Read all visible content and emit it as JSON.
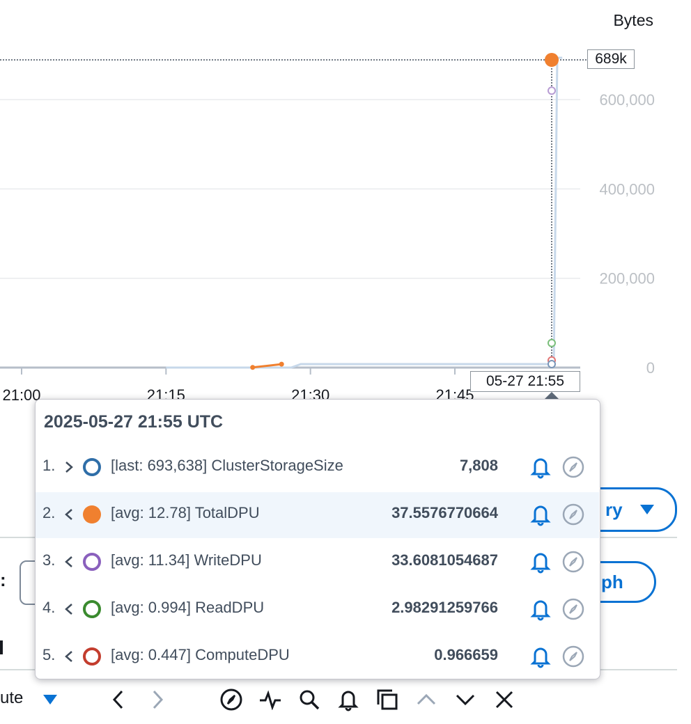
{
  "chart_data": {
    "type": "line",
    "ylabel": "Bytes",
    "yticks": [
      "0",
      "200,000",
      "400,000",
      "600,000"
    ],
    "ylim": [
      0,
      700000
    ],
    "xticks": [
      "21:00",
      "21:15",
      "21:30",
      "21:45"
    ],
    "xlim_minutes": [
      0,
      61
    ],
    "hover_value_label": "689k",
    "hover_time_label": "05-27 21:55",
    "series": [
      {
        "name": "ClusterStorageSize",
        "color": "#c7d8ea",
        "points": [
          [
            15,
            0
          ],
          [
            28,
            0
          ],
          [
            29,
            7808
          ],
          [
            55,
            7808
          ],
          [
            55.4,
            693638
          ],
          [
            56,
            693638
          ]
        ]
      },
      {
        "name": "TotalDPU",
        "color": "#f0802f",
        "points": [
          [
            24,
            400
          ],
          [
            27,
            7600
          ]
        ]
      }
    ],
    "hover_markers": [
      {
        "name": "TotalDPU",
        "color": "#f0802f",
        "value": 689000,
        "filled": true
      },
      {
        "name": "WriteDPU",
        "color": "#b79bd3",
        "value": 620000,
        "filled": false
      },
      {
        "name": "ReadDPU",
        "color": "#7bbf7b",
        "value": 55000,
        "filled": false
      },
      {
        "name": "ComputeDPU",
        "color": "#e27676",
        "value": 16000,
        "filled": false
      },
      {
        "name": "ClusterStorageSize",
        "color": "#7a96b8",
        "value": 7808,
        "filled": false
      }
    ]
  },
  "popover": {
    "title": "2025-05-27 21:55 UTC",
    "rows": [
      {
        "num": "1.",
        "chevron": "right",
        "color": "#2f6ea8",
        "filled": false,
        "label": "[last: 693,638] ClusterStorageSize",
        "value": "7,808",
        "highlight": false
      },
      {
        "num": "2.",
        "chevron": "left",
        "color": "#f0802f",
        "filled": true,
        "label": "[avg: 12.78] TotalDPU",
        "value": "37.5576770664",
        "highlight": true
      },
      {
        "num": "3.",
        "chevron": "left",
        "color": "#8a60bd",
        "filled": false,
        "label": "[avg: 11.34] WriteDPU",
        "value": "33.6081054687",
        "highlight": false
      },
      {
        "num": "4.",
        "chevron": "left",
        "color": "#3a8a2e",
        "filled": false,
        "label": "[avg: 0.994] ReadDPU",
        "value": "2.98291259766",
        "highlight": false
      },
      {
        "num": "5.",
        "chevron": "left",
        "color": "#c33d2e",
        "filled": false,
        "label": "[avg: 0.447] ComputeDPU",
        "value": "0.966659",
        "highlight": false
      }
    ]
  },
  "background": {
    "query_btn_label": "ry",
    "graph_btn_label": "ph",
    "colon_label": ":",
    "statistic_label": "ute"
  },
  "toolbar_icons": [
    "chevron-left-icon",
    "chevron-right-icon",
    "compass-icon",
    "activity-icon",
    "search-icon",
    "bell-icon",
    "copy-icon",
    "chevron-up-icon",
    "chevron-down-icon",
    "close-icon"
  ]
}
